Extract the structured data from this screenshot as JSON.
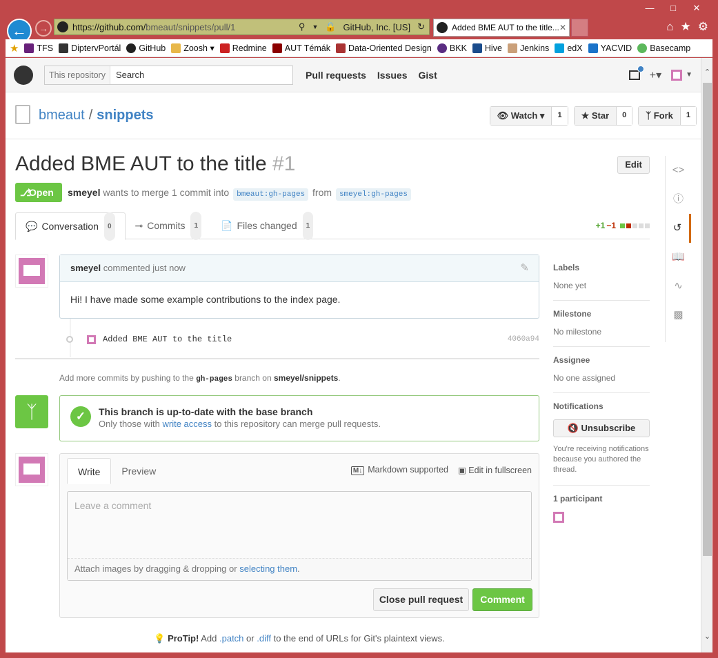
{
  "window": {
    "minimize": "—",
    "maximize": "□",
    "close": "✕"
  },
  "browser": {
    "url_host": "https://github.com/",
    "url_path": "bmeaut/snippets/pull/1",
    "cert": "GitHub, Inc. [US]",
    "tab_title": "Added BME AUT to the title...",
    "favorites": [
      "TFS",
      "DiptervPortál",
      "GitHub",
      "Zoosh",
      "Redmine",
      "AUT Témák",
      "Data-Oriented Design",
      "BKK",
      "Hive",
      "Jenkins",
      "edX",
      "YACVID",
      "Basecamp"
    ]
  },
  "header": {
    "search_scope": "This repository",
    "search_placeholder": "Search",
    "nav": [
      "Pull requests",
      "Issues",
      "Gist"
    ]
  },
  "repo": {
    "owner": "bmeaut",
    "name": "snippets",
    "watch_label": "Watch",
    "watch_count": "1",
    "star_label": "Star",
    "star_count": "0",
    "fork_label": "Fork",
    "fork_count": "1"
  },
  "pr": {
    "title": "Added BME AUT to the title",
    "number": "#1",
    "edit_label": "Edit",
    "state": "Open",
    "author": "smeyel",
    "merge_text": "wants to merge 1 commit into",
    "base_branch": "bmeaut:gh-pages",
    "from": "from",
    "head_branch": "smeyel:gh-pages",
    "tabs": [
      {
        "label": "Conversation",
        "count": "0"
      },
      {
        "label": "Commits",
        "count": "1"
      },
      {
        "label": "Files changed",
        "count": "1"
      }
    ],
    "diff_add": "+1",
    "diff_del": "−1"
  },
  "comment": {
    "author": "smeyel",
    "meta": "commented just now",
    "body": "Hi! I have made some example contributions to the index page."
  },
  "commit": {
    "message": "Added BME AUT to the title",
    "sha": "4060a94"
  },
  "push_note": {
    "prefix": "Add more commits by pushing to the",
    "branch": "gh-pages",
    "mid": "branch on",
    "repo": "smeyel/snippets",
    "suffix": "."
  },
  "merge": {
    "heading": "This branch is up-to-date with the base branch",
    "sub_prefix": "Only those with",
    "sub_link": "write access",
    "sub_suffix": "to this repository can merge pull requests."
  },
  "new_comment": {
    "write": "Write",
    "preview": "Preview",
    "markdown": "Markdown supported",
    "fullscreen": "Edit in fullscreen",
    "placeholder": "Leave a comment",
    "drop_prefix": "Attach images by dragging & dropping or",
    "drop_link": "selecting them",
    "close_label": "Close pull request",
    "comment_label": "Comment"
  },
  "protip": {
    "label": "ProTip!",
    "t1": "Add",
    "patch": ".patch",
    "or": "or",
    "diff": ".diff",
    "t2": "to the end of URLs for Git's plaintext views."
  },
  "sidebar": {
    "labels_h": "Labels",
    "labels_v": "None yet",
    "milestone_h": "Milestone",
    "milestone_v": "No milestone",
    "assignee_h": "Assignee",
    "assignee_v": "No one assigned",
    "notif_h": "Notifications",
    "unsub": "Unsubscribe",
    "notif_text": "You're receiving notifications because you authored the thread.",
    "participants_h": "1 participant"
  },
  "colors": {
    "open_green": "#6cc644",
    "link_blue": "#4183c4",
    "avatar_pink": "#d279b5",
    "browser_frame": "#c0484a"
  }
}
